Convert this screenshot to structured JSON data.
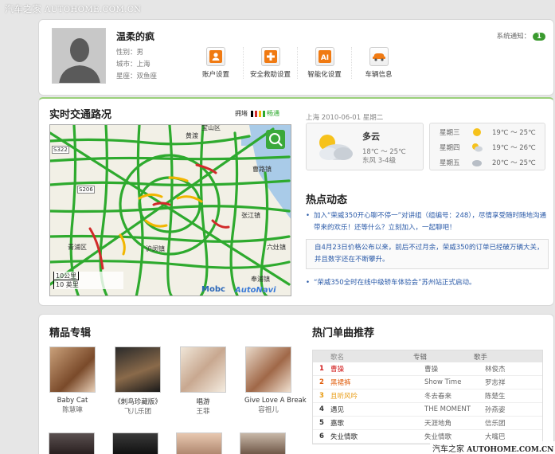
{
  "watermark_top": {
    "site": "汽车之家",
    "url": "AUTOHOME.COM.CN"
  },
  "watermark_bottom": {
    "site": "汽车之家",
    "url": "AUTOHOME.COM.CN"
  },
  "profile": {
    "username": "温柔的疯",
    "gender": "性别：男",
    "city": "城市：上海",
    "sign": "星座：双鱼座",
    "notify_label": "系统通知：",
    "notify_count": "1",
    "actions": [
      {
        "label": "账户设置",
        "icon": "person-icon"
      },
      {
        "label": "安全救助设置",
        "icon": "plus-icon"
      },
      {
        "label": "智能化设置",
        "icon": "ai-icon"
      },
      {
        "label": "车辆信息",
        "icon": "car-icon"
      }
    ]
  },
  "traffic": {
    "title": "实时交通路况",
    "legend_jam": "拥堵",
    "legend_clear": "畅通",
    "colors": [
      "#000000",
      "#d12a2a",
      "#f2b600",
      "#2eaa2e"
    ],
    "map_scale_km": "10公里",
    "map_scale_mi": "10 英里",
    "map_labels": [
      "宝山区",
      "黄渡",
      "S322",
      "S206",
      "青浦区",
      "曹路镇",
      "张江镇",
      "六灶镇",
      "奉浦镇",
      "沪闵镇"
    ],
    "map_logo_left": "Mobc",
    "map_logo_right": "AutoNavi"
  },
  "weather": {
    "date": "上海 2010-06-01 星期二",
    "today_cond": "多云",
    "today_temp": "18℃ ～ 25℃",
    "today_wind": "东风 3-4级",
    "forecast": [
      {
        "day": "星期三",
        "icon": "sunny-icon",
        "range": "19℃ ～ 25℃"
      },
      {
        "day": "星期四",
        "icon": "partly-cloudy-icon",
        "range": "19℃ ～ 26℃"
      },
      {
        "day": "星期五",
        "icon": "cloudy-icon",
        "range": "20℃ ～ 25℃"
      }
    ]
  },
  "news": {
    "title": "热点动态",
    "items": [
      "加入“荣威350开心聊不停一”对讲组（组编号：248），尽情享受随时随地沟通带来的欢乐！还等什么？立刻加入，一起聊吧！",
      "自4月23日价格公布以来，前后不过月余，荣威350的订单已经破万辆大关，并且数字还在不断攀升。",
      "“荣威350全时在线中级轿车体验会”苏州站正式启动。"
    ]
  },
  "albums": {
    "title": "精品专辑",
    "items": [
      {
        "title": "Baby Cat",
        "artist": "陈慧琳"
      },
      {
        "title": "《刺鸟珍藏版》",
        "artist": "飞儿乐团"
      },
      {
        "title": "唱游",
        "artist": "王菲"
      },
      {
        "title": "Give Love A Break",
        "artist": "容祖儿"
      }
    ]
  },
  "songs": {
    "title": "热门单曲推荐",
    "headers": [
      "歌名",
      "专辑",
      "歌手"
    ],
    "rows": [
      {
        "rank": "1",
        "name": "曹操",
        "album": "曹操",
        "artist": "林俊杰"
      },
      {
        "rank": "2",
        "name": "黑裙裤",
        "album": "Show Time",
        "artist": "罗志祥"
      },
      {
        "rank": "3",
        "name": "且听风吟",
        "album": "冬去春来",
        "artist": "陈楚生"
      },
      {
        "rank": "4",
        "name": "遇见",
        "album": "THE MOMENT",
        "artist": "孙燕姿"
      },
      {
        "rank": "5",
        "name": "嘉歌",
        "album": "天涯地角",
        "artist": "信乐团"
      },
      {
        "rank": "6",
        "name": "失业情歌",
        "album": "失业情歌",
        "artist": "大嘴巴"
      }
    ],
    "rank_colors": [
      "#d01818",
      "#e06010",
      "#e89a10",
      "#333333",
      "#333333",
      "#333333"
    ]
  }
}
